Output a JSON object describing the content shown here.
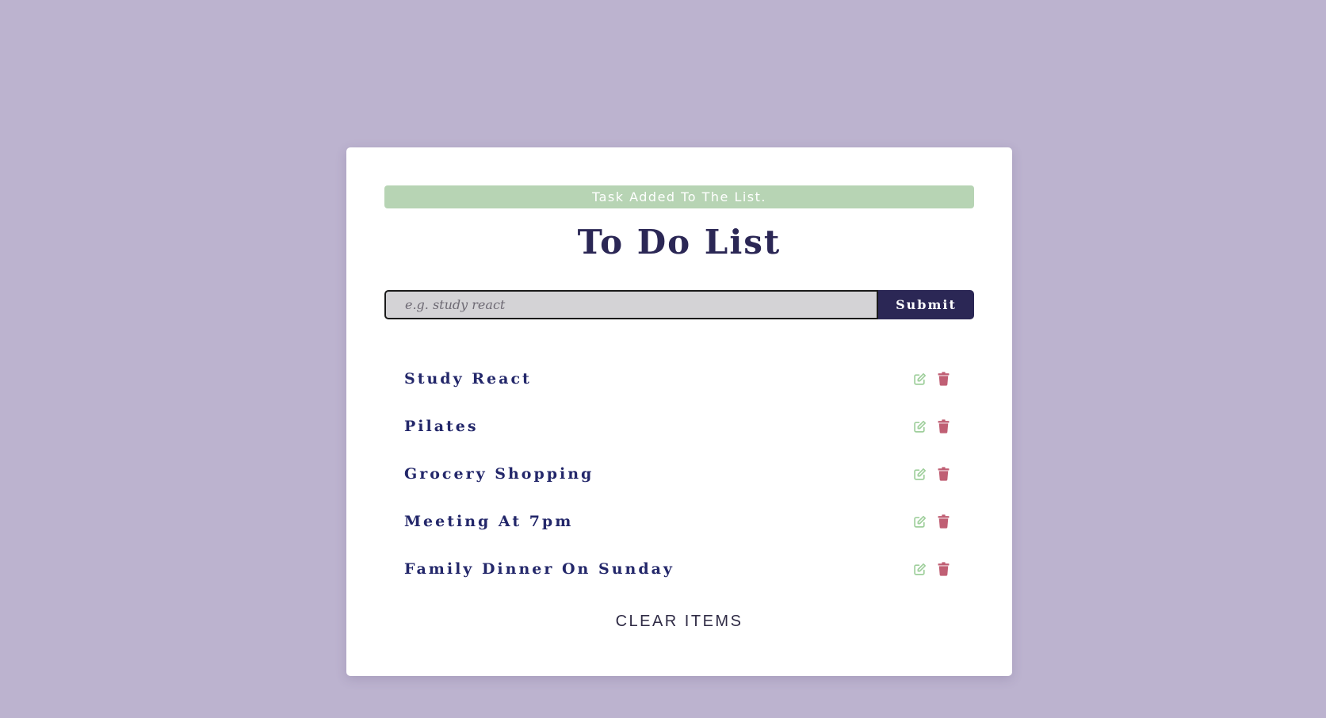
{
  "alert": {
    "text": "Task Added To The List."
  },
  "header": {
    "title": "To Do List"
  },
  "form": {
    "placeholder": "e.g. study react",
    "submit_label": "Submit"
  },
  "items": [
    {
      "title": "Study React"
    },
    {
      "title": "Pilates"
    },
    {
      "title": "Grocery Shopping"
    },
    {
      "title": "Meeting At 7pm"
    },
    {
      "title": "Family Dinner On Sunday"
    }
  ],
  "clear_label": "CLEAR ITEMS",
  "icons": {
    "edit": "edit-icon",
    "delete": "trash-icon"
  },
  "colors": {
    "background": "#bcb3cf",
    "alert": "#b7d4b4",
    "primary": "#2b2755",
    "item_text": "#23276a",
    "edit_icon": "#9fcf9c",
    "delete_icon": "#c05f74"
  }
}
